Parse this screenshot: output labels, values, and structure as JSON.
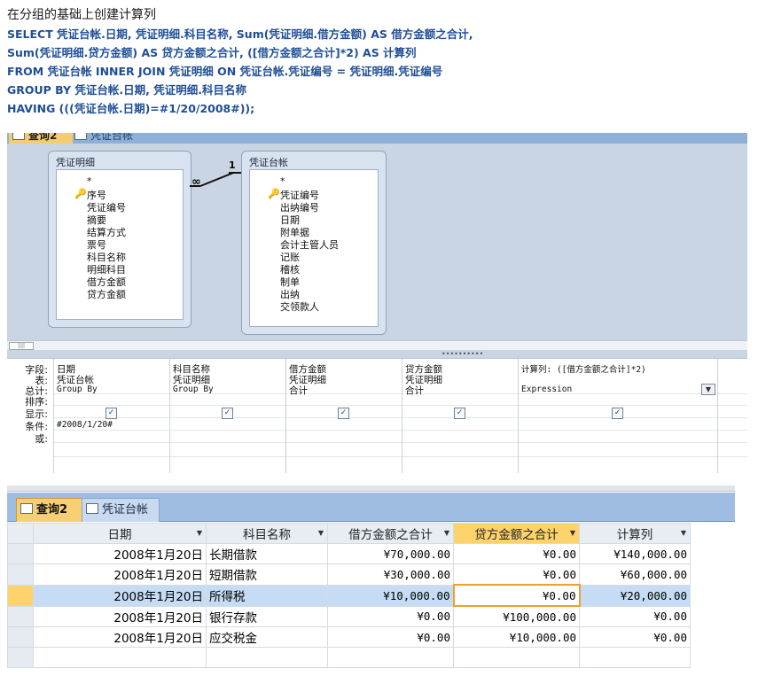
{
  "heading": "在分组的基础上创建计算列",
  "sql_lines": [
    "SELECT 凭证台帐.日期, 凭证明细.科目名称, Sum(凭证明细.借方金额) AS 借方金额之合计,",
    "Sum(凭证明细.贷方金额) AS 贷方金额之合计, ([借方金额之合计]*2) AS 计算列",
    "FROM 凭证台帐 INNER JOIN 凭证明细 ON 凭证台帐.凭证编号 = 凭证明细.凭证编号",
    "GROUP BY 凭证台帐.日期, 凭证明细.科目名称",
    "HAVING (((凭证台帐.日期)=#1/20/2008#));"
  ],
  "design": {
    "tabs": [
      "查询2",
      "凭证台帐"
    ],
    "tables": [
      {
        "title": "凭证明细",
        "fields": [
          "*",
          "序号",
          "凭证编号",
          "摘要",
          "结算方式",
          "票号",
          "科目名称",
          "明细科目",
          "借方金额",
          "贷方金额"
        ]
      },
      {
        "title": "凭证台帐",
        "fields": [
          "*",
          "凭证编号",
          "出纳编号",
          "日期",
          "附单据",
          "会计主管人员",
          "记账",
          "稽核",
          "制单",
          "出纳",
          "交领款人"
        ]
      }
    ],
    "relation": {
      "many": "∞",
      "one": "1"
    },
    "row_labels": [
      "字段:",
      "表:",
      "总计:",
      "排序:",
      "显示:",
      "条件:",
      "或:"
    ],
    "columns": [
      {
        "field": "日期",
        "table": "凭证台帐",
        "total": "Group By",
        "show": true,
        "criteria": "#2008/1/20#"
      },
      {
        "field": "科目名称",
        "table": "凭证明细",
        "total": "Group By",
        "show": true,
        "criteria": ""
      },
      {
        "field": "借方金额",
        "table": "凭证明细",
        "total": "合计",
        "show": true,
        "criteria": ""
      },
      {
        "field": "贷方金额",
        "table": "凭证明细",
        "total": "合计",
        "show": true,
        "criteria": ""
      },
      {
        "field": "计算列: ([借方金额之合计]*2)",
        "table": "",
        "total": "Expression",
        "show": true,
        "criteria": ""
      }
    ]
  },
  "datasheet": {
    "tabs": [
      "查询2",
      "凭证台帐"
    ],
    "headers": [
      "日期",
      "科目名称",
      "借方金额之合计",
      "贷方金额之合计",
      "计算列"
    ],
    "selected_header": 3,
    "current_row": 2,
    "rows": [
      [
        "2008年1月20日",
        "长期借款",
        "¥70,000.00",
        "¥0.00",
        "¥140,000.00"
      ],
      [
        "2008年1月20日",
        "短期借款",
        "¥30,000.00",
        "¥0.00",
        "¥60,000.00"
      ],
      [
        "2008年1月20日",
        "所得税",
        "¥10,000.00",
        "¥0.00",
        "¥20,000.00"
      ],
      [
        "2008年1月20日",
        "银行存款",
        "¥0.00",
        "¥100,000.00",
        "¥0.00"
      ],
      [
        "2008年1月20日",
        "应交税金",
        "¥0.00",
        "¥10,000.00",
        "¥0.00"
      ]
    ]
  }
}
